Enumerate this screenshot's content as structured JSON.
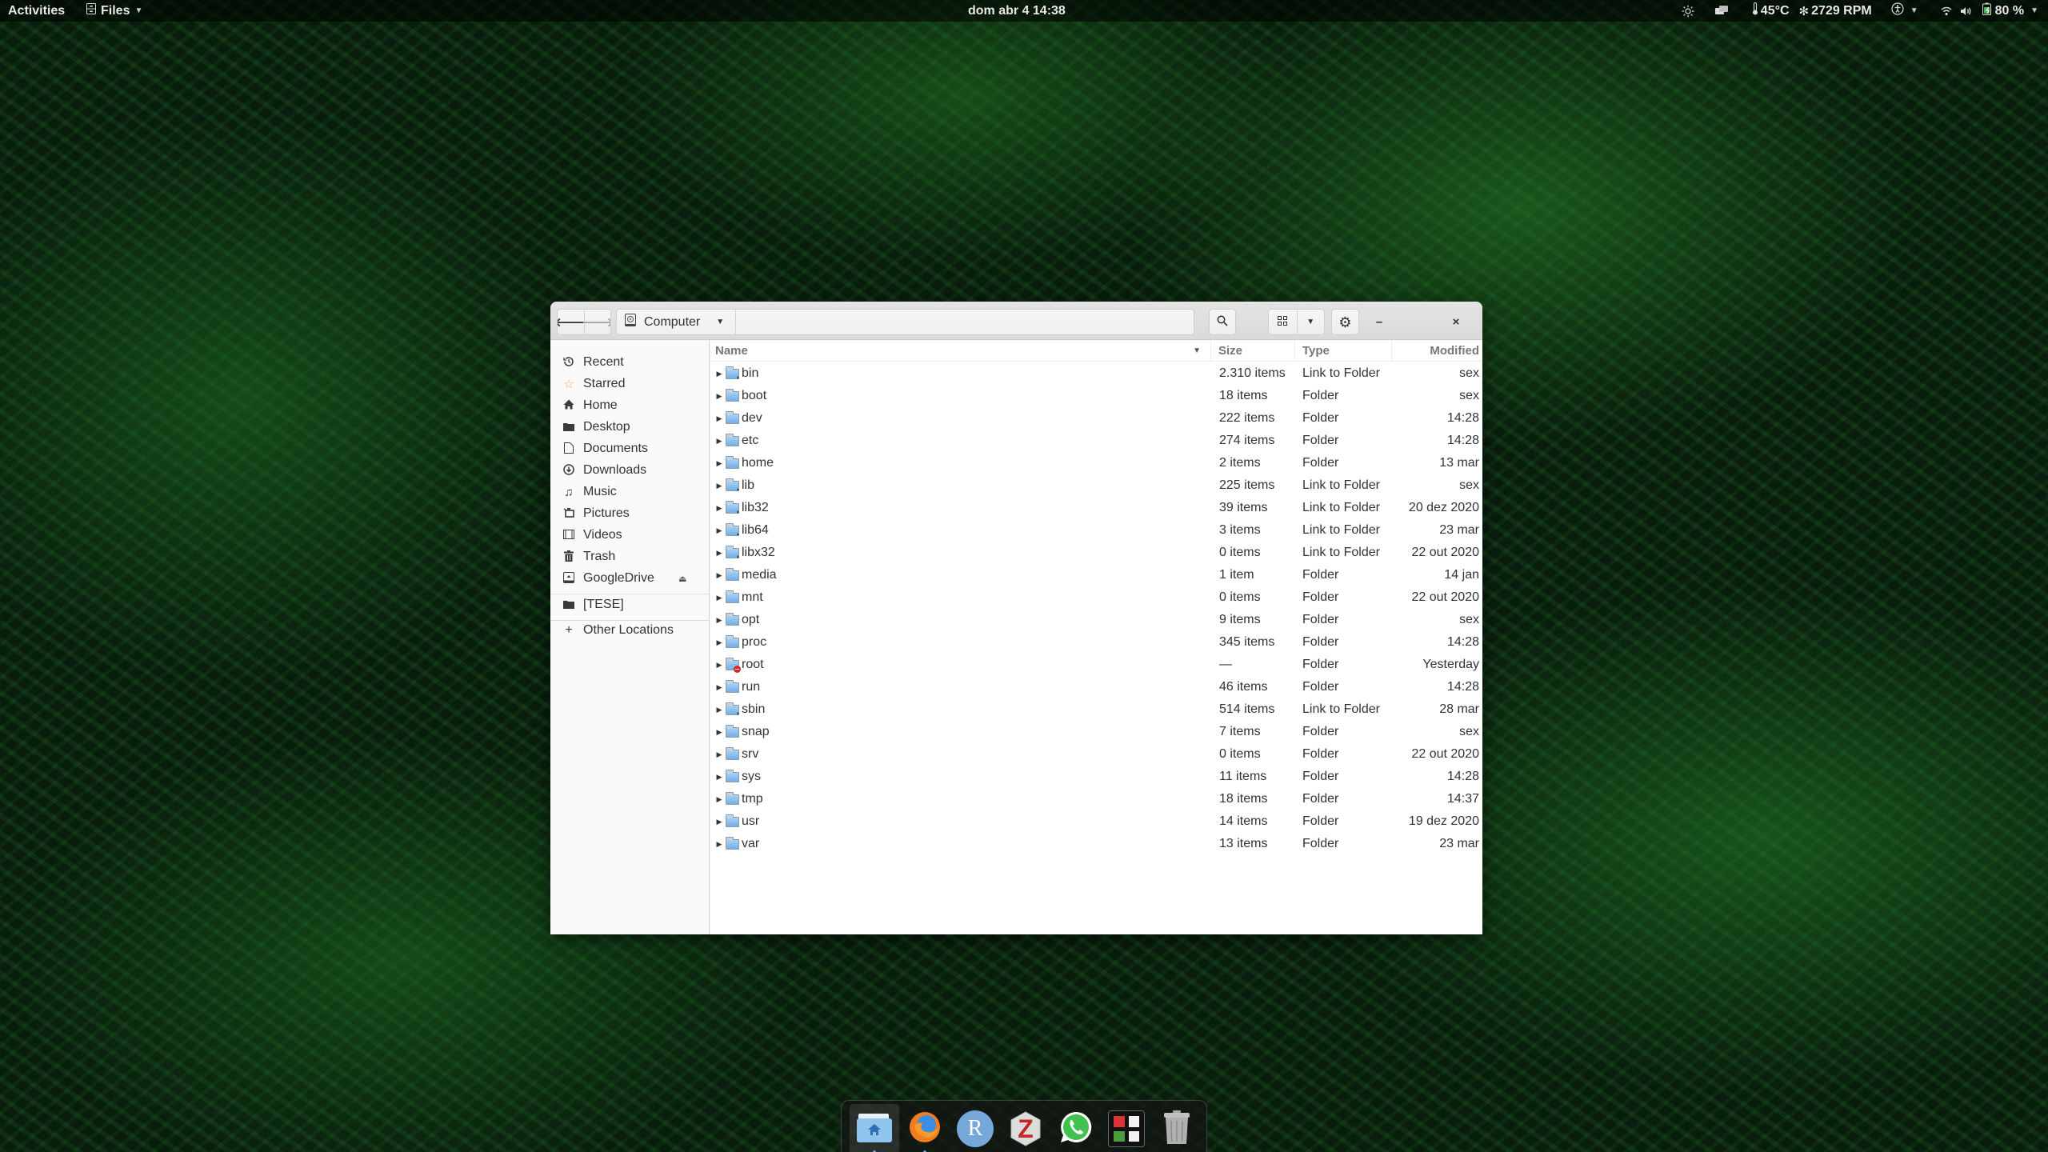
{
  "topbar": {
    "activities": "Activities",
    "app_name": "Files",
    "clock": "dom abr 4  14:38",
    "temperature": "45°C",
    "fan_speed": "2729 RPM",
    "battery": "80 %",
    "icons": [
      "brightness-icon",
      "display-icon",
      "thermometer-icon",
      "fan-icon",
      "accessibility-icon",
      "wifi-icon",
      "volume-icon",
      "battery-charging-icon"
    ]
  },
  "window": {
    "location": "Computer",
    "search_icon": "search-icon",
    "view_icon": "grid-view-icon",
    "menu_icon": "gear-icon",
    "minimize": "–",
    "close": "×"
  },
  "sidebar": {
    "items": [
      {
        "label": "Recent",
        "icon": "recent-icon"
      },
      {
        "label": "Starred",
        "icon": "star-icon"
      },
      {
        "label": "Home",
        "icon": "home-icon"
      },
      {
        "label": "Desktop",
        "icon": "folder-icon"
      },
      {
        "label": "Documents",
        "icon": "document-icon"
      },
      {
        "label": "Downloads",
        "icon": "download-icon"
      },
      {
        "label": "Music",
        "icon": "music-icon"
      },
      {
        "label": "Pictures",
        "icon": "pictures-icon"
      },
      {
        "label": "Videos",
        "icon": "video-icon"
      },
      {
        "label": "Trash",
        "icon": "trash-icon"
      },
      {
        "label": "GoogleDrive",
        "icon": "drive-icon",
        "eject": true
      },
      {
        "label": "[TESE]",
        "icon": "folder-icon"
      },
      {
        "label": "Other Locations",
        "icon": "plus-icon"
      }
    ]
  },
  "list": {
    "columns": {
      "name": "Name",
      "size": "Size",
      "type": "Type",
      "modified": "Modified"
    },
    "rows": [
      {
        "name": "bin",
        "size": "2.310 items",
        "type": "Link to Folder",
        "modified": "sex",
        "kind": "link"
      },
      {
        "name": "boot",
        "size": "18 items",
        "type": "Folder",
        "modified": "sex",
        "kind": "folder"
      },
      {
        "name": "dev",
        "size": "222 items",
        "type": "Folder",
        "modified": "14:28",
        "kind": "folder"
      },
      {
        "name": "etc",
        "size": "274 items",
        "type": "Folder",
        "modified": "14:28",
        "kind": "folder"
      },
      {
        "name": "home",
        "size": "2 items",
        "type": "Folder",
        "modified": "13 mar",
        "kind": "folder"
      },
      {
        "name": "lib",
        "size": "225 items",
        "type": "Link to Folder",
        "modified": "sex",
        "kind": "link"
      },
      {
        "name": "lib32",
        "size": "39 items",
        "type": "Link to Folder",
        "modified": "20 dez 2020",
        "kind": "link"
      },
      {
        "name": "lib64",
        "size": "3 items",
        "type": "Link to Folder",
        "modified": "23 mar",
        "kind": "link"
      },
      {
        "name": "libx32",
        "size": "0 items",
        "type": "Link to Folder",
        "modified": "22 out 2020",
        "kind": "link"
      },
      {
        "name": "media",
        "size": "1 item",
        "type": "Folder",
        "modified": "14 jan",
        "kind": "folder"
      },
      {
        "name": "mnt",
        "size": "0 items",
        "type": "Folder",
        "modified": "22 out 2020",
        "kind": "folder"
      },
      {
        "name": "opt",
        "size": "9 items",
        "type": "Folder",
        "modified": "sex",
        "kind": "folder"
      },
      {
        "name": "proc",
        "size": "345 items",
        "type": "Folder",
        "modified": "14:28",
        "kind": "folder"
      },
      {
        "name": "root",
        "size": "—",
        "type": "Folder",
        "modified": "Yesterday",
        "kind": "denied"
      },
      {
        "name": "run",
        "size": "46 items",
        "type": "Folder",
        "modified": "14:28",
        "kind": "folder"
      },
      {
        "name": "sbin",
        "size": "514 items",
        "type": "Link to Folder",
        "modified": "28 mar",
        "kind": "link"
      },
      {
        "name": "snap",
        "size": "7 items",
        "type": "Folder",
        "modified": "sex",
        "kind": "folder"
      },
      {
        "name": "srv",
        "size": "0 items",
        "type": "Folder",
        "modified": "22 out 2020",
        "kind": "folder"
      },
      {
        "name": "sys",
        "size": "11 items",
        "type": "Folder",
        "modified": "14:28",
        "kind": "folder"
      },
      {
        "name": "tmp",
        "size": "18 items",
        "type": "Folder",
        "modified": "14:37",
        "kind": "folder"
      },
      {
        "name": "usr",
        "size": "14 items",
        "type": "Folder",
        "modified": "19 dez 2020",
        "kind": "folder"
      },
      {
        "name": "var",
        "size": "13 items",
        "type": "Folder",
        "modified": "23 mar",
        "kind": "folder"
      }
    ]
  },
  "dock": {
    "items": [
      {
        "name": "files",
        "icon": "files-home-icon",
        "running": true,
        "active": true
      },
      {
        "name": "firefox",
        "icon": "firefox-icon",
        "running": true
      },
      {
        "name": "rstudio",
        "icon": "r-icon",
        "label": "R"
      },
      {
        "name": "zotero",
        "icon": "zotero-icon",
        "label": "Z"
      },
      {
        "name": "whatsapp",
        "icon": "whatsapp-icon"
      },
      {
        "name": "app-grid",
        "icon": "app-grid-icon"
      },
      {
        "name": "trash",
        "icon": "trash-icon"
      }
    ]
  }
}
